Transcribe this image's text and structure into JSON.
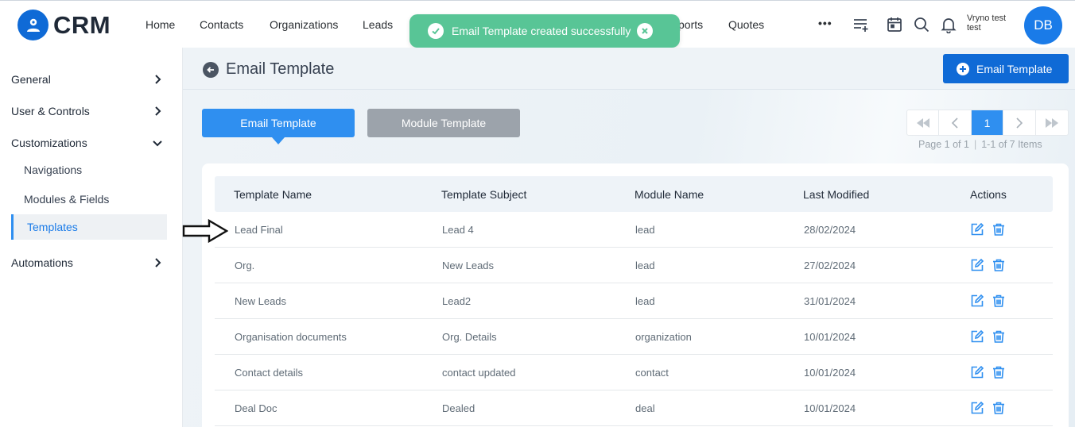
{
  "app": {
    "logo_text": "CRM",
    "accent": "#0f6ad6"
  },
  "topnav": {
    "items": [
      "Home",
      "Contacts",
      "Organizations",
      "Leads",
      "ports",
      "Quotes"
    ],
    "more_label": "•••",
    "user_name": "Vryno test test",
    "avatar_initials": "DB"
  },
  "toast": {
    "message": "Email Template created successfully",
    "color": "#58c596"
  },
  "sidebar": {
    "sections": [
      {
        "label": "General",
        "expanded": false
      },
      {
        "label": "User & Controls",
        "expanded": false
      },
      {
        "label": "Customizations",
        "expanded": true
      },
      {
        "label": "Automations",
        "expanded": false
      }
    ],
    "sub_items": [
      "Navigations",
      "Modules & Fields",
      "Templates"
    ],
    "active_item": "Templates"
  },
  "page": {
    "title": "Email Template",
    "add_button_label": "Email Template"
  },
  "tabs": [
    {
      "label": "Email Template",
      "active": true
    },
    {
      "label": "Module Template",
      "active": false
    }
  ],
  "pagination": {
    "current_page": "1",
    "page_info": "Page 1 of 1",
    "items_info": "1-1 of 7 Items",
    "separator": "|"
  },
  "table": {
    "columns": [
      "Template Name",
      "Template Subject",
      "Module Name",
      "Last Modified",
      "Actions"
    ],
    "rows": [
      [
        "Lead Final",
        "Lead 4",
        "lead",
        "28/02/2024"
      ],
      [
        "Org.",
        "New Leads",
        "lead",
        "27/02/2024"
      ],
      [
        "New Leads",
        "Lead2",
        "lead",
        "31/01/2024"
      ],
      [
        "Organisation documents",
        "Org. Details",
        "organization",
        "10/01/2024"
      ],
      [
        "Contact details",
        "contact updated",
        "contact",
        "10/01/2024"
      ],
      [
        "Deal Doc",
        "Dealed",
        "deal",
        "10/01/2024"
      ]
    ]
  }
}
